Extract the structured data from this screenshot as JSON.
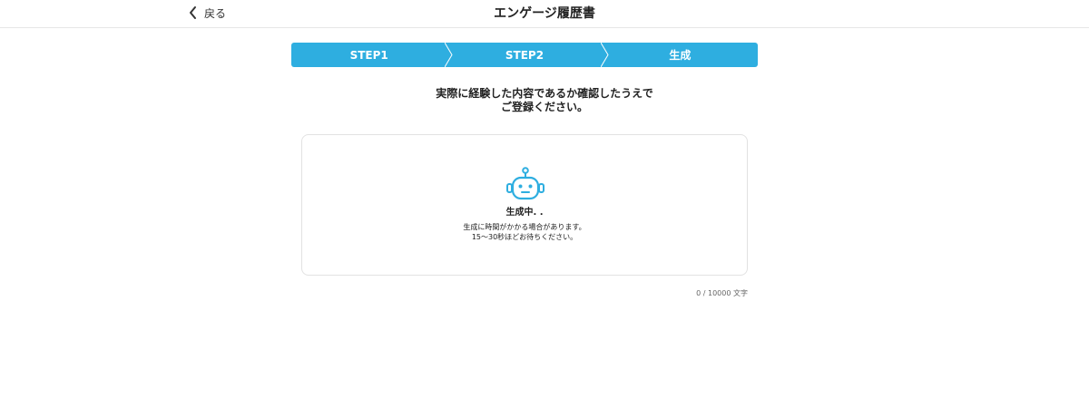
{
  "header": {
    "back_label": "戻る",
    "title": "エンゲージ履歴書"
  },
  "steps": {
    "items": [
      {
        "label": "STEP1"
      },
      {
        "label": "STEP2"
      },
      {
        "label": "生成"
      }
    ],
    "color": "#2eaee0"
  },
  "instruction": {
    "line1": "実際に経験した内容であるか確認したうえで",
    "line2": "ご登録ください。"
  },
  "generation": {
    "icon": "robot-icon",
    "icon_color": "#2eaee0",
    "status": "生成中",
    "dots": ". .",
    "note_line1": "生成に時間がかかる場合があります。",
    "note_line2": "15〜30秒ほどお待ちください。"
  },
  "counter": {
    "text": "0 / 10000 文字"
  }
}
